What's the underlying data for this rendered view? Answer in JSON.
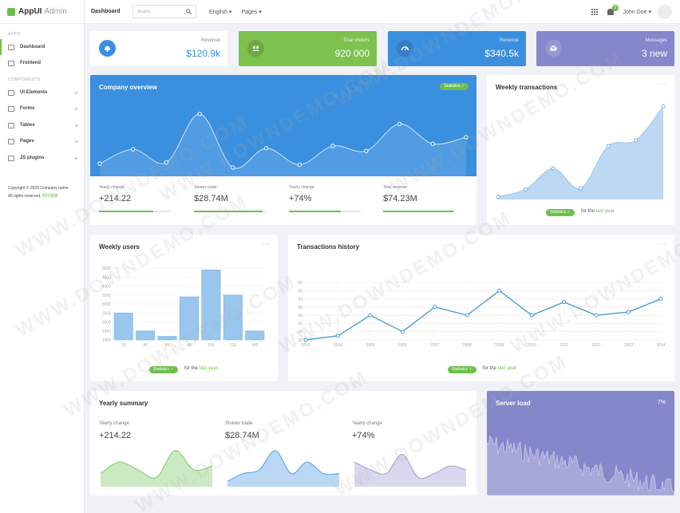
{
  "brand": {
    "name": "AppUI",
    "sub": "Admin"
  },
  "sidebar": {
    "section_apps": "APPS",
    "section_components": "COMPONENTS",
    "items": [
      {
        "label": "Dashboard"
      },
      {
        "label": "Frontend"
      },
      {
        "label": "UI Elements"
      },
      {
        "label": "Forms"
      },
      {
        "label": "Tables"
      },
      {
        "label": "Pages"
      },
      {
        "label": "JS plugins"
      }
    ],
    "copyright": "Copyright © 2020 Company name",
    "rights": "All rights reserved.",
    "rights_link": "网页模板"
  },
  "topbar": {
    "title": "Dashboard",
    "search_placeholder": "Search...",
    "language": "English",
    "pages": "Pages",
    "notif_count": "3",
    "user": "John Doe"
  },
  "stats": [
    {
      "label": "Revenue",
      "value": "$120.9k",
      "color": "#3b8fe0"
    },
    {
      "label": "Total visitors",
      "value": "920 000",
      "color": "#7dc14f"
    },
    {
      "label": "Revenue",
      "value": "$340.5k",
      "color": "#3a8fde"
    },
    {
      "label": "Messages",
      "value": "3 new",
      "color": "#8587cb"
    }
  ],
  "overview": {
    "title": "Company overview",
    "pill": "Statistics",
    "minis": [
      {
        "label": "Yearly change",
        "value": "+214.22",
        "progress": 0.75
      },
      {
        "label": "Shares trade",
        "value": "$28.74M",
        "progress": 0.95
      },
      {
        "label": "Yearly change",
        "value": "+74%",
        "progress": 0.72
      },
      {
        "label": "Total revenue",
        "value": "$74.23M",
        "progress": 0.98
      }
    ]
  },
  "weekly_transactions": {
    "title": "Weekly transactions",
    "pill": "Statistics",
    "foot_text": "for the",
    "foot_link": "last year"
  },
  "weekly_users": {
    "title": "Weekly users",
    "pill": "Statistics",
    "foot_text": "for the",
    "foot_link": "last year"
  },
  "transactions_history": {
    "title": "Transactions history",
    "pill": "Statistics",
    "foot_text": "for the",
    "foot_link": "last year"
  },
  "yearly_summary": {
    "title": "Yearly summary",
    "items": [
      {
        "label": "Yearly change",
        "value": "+214.22"
      },
      {
        "label": "Shares trade",
        "value": "$28.74M"
      },
      {
        "label": "Yearly change",
        "value": "+74%"
      }
    ]
  },
  "server_load": {
    "title": "Server load",
    "percent": "7%"
  },
  "watermark": "WWW.DOWNDEMO.COM",
  "chart_data": [
    {
      "type": "area",
      "name": "overview",
      "values": [
        1,
        3.6,
        1.2,
        10,
        0.3,
        3.8,
        0.8,
        4.2,
        3.3,
        8.2,
        4.6,
        5.8
      ],
      "ylim": [
        0,
        11
      ],
      "color": "#3a8fde",
      "grid": false
    },
    {
      "type": "area",
      "name": "weekly_transactions",
      "values": [
        0.5,
        1.8,
        5.5,
        2,
        9.5,
        10.5,
        16.5
      ],
      "ylim": [
        0,
        17
      ],
      "color": "#bcd8f2",
      "grid": false
    },
    {
      "type": "bar",
      "name": "weekly_users",
      "categories": [
        "20",
        "40",
        "60",
        "80",
        "100",
        "120",
        "140"
      ],
      "values": [
        2500,
        1500,
        1200,
        3400,
        4900,
        3500,
        1500
      ],
      "ylim": [
        1000,
        5000
      ],
      "yticks": [
        1000,
        1500,
        2000,
        2500,
        3000,
        3500,
        4000,
        4500,
        5000
      ],
      "color": "#99c6ed",
      "grid": true
    },
    {
      "type": "line",
      "name": "transactions_history",
      "x": [
        "2003",
        "2004",
        "2005",
        "2006",
        "2007",
        "2008",
        "2009",
        "2010",
        "2011",
        "2012",
        "2013",
        "2014"
      ],
      "values": [
        25,
        27.5,
        40,
        30,
        45,
        40,
        55,
        40,
        48,
        40,
        42,
        50
      ],
      "ylim": [
        25,
        60
      ],
      "yticks": [
        25,
        30,
        35,
        40,
        45,
        50,
        55,
        60
      ],
      "color": "#4a9fd8",
      "grid": true
    },
    {
      "type": "area",
      "name": "summary_1",
      "values": [
        3,
        6,
        4,
        2,
        9,
        4,
        5
      ],
      "ylim": [
        0,
        10
      ],
      "color": "#8bd07a"
    },
    {
      "type": "area",
      "name": "summary_2",
      "values": [
        1,
        3,
        4,
        9,
        3,
        6,
        3,
        3
      ],
      "ylim": [
        0,
        10
      ],
      "color": "#67a9e6"
    },
    {
      "type": "area",
      "name": "summary_3",
      "values": [
        6,
        4,
        3,
        8,
        2,
        3,
        5,
        4
      ],
      "ylim": [
        0,
        10
      ],
      "color": "#a6a9d8"
    }
  ]
}
